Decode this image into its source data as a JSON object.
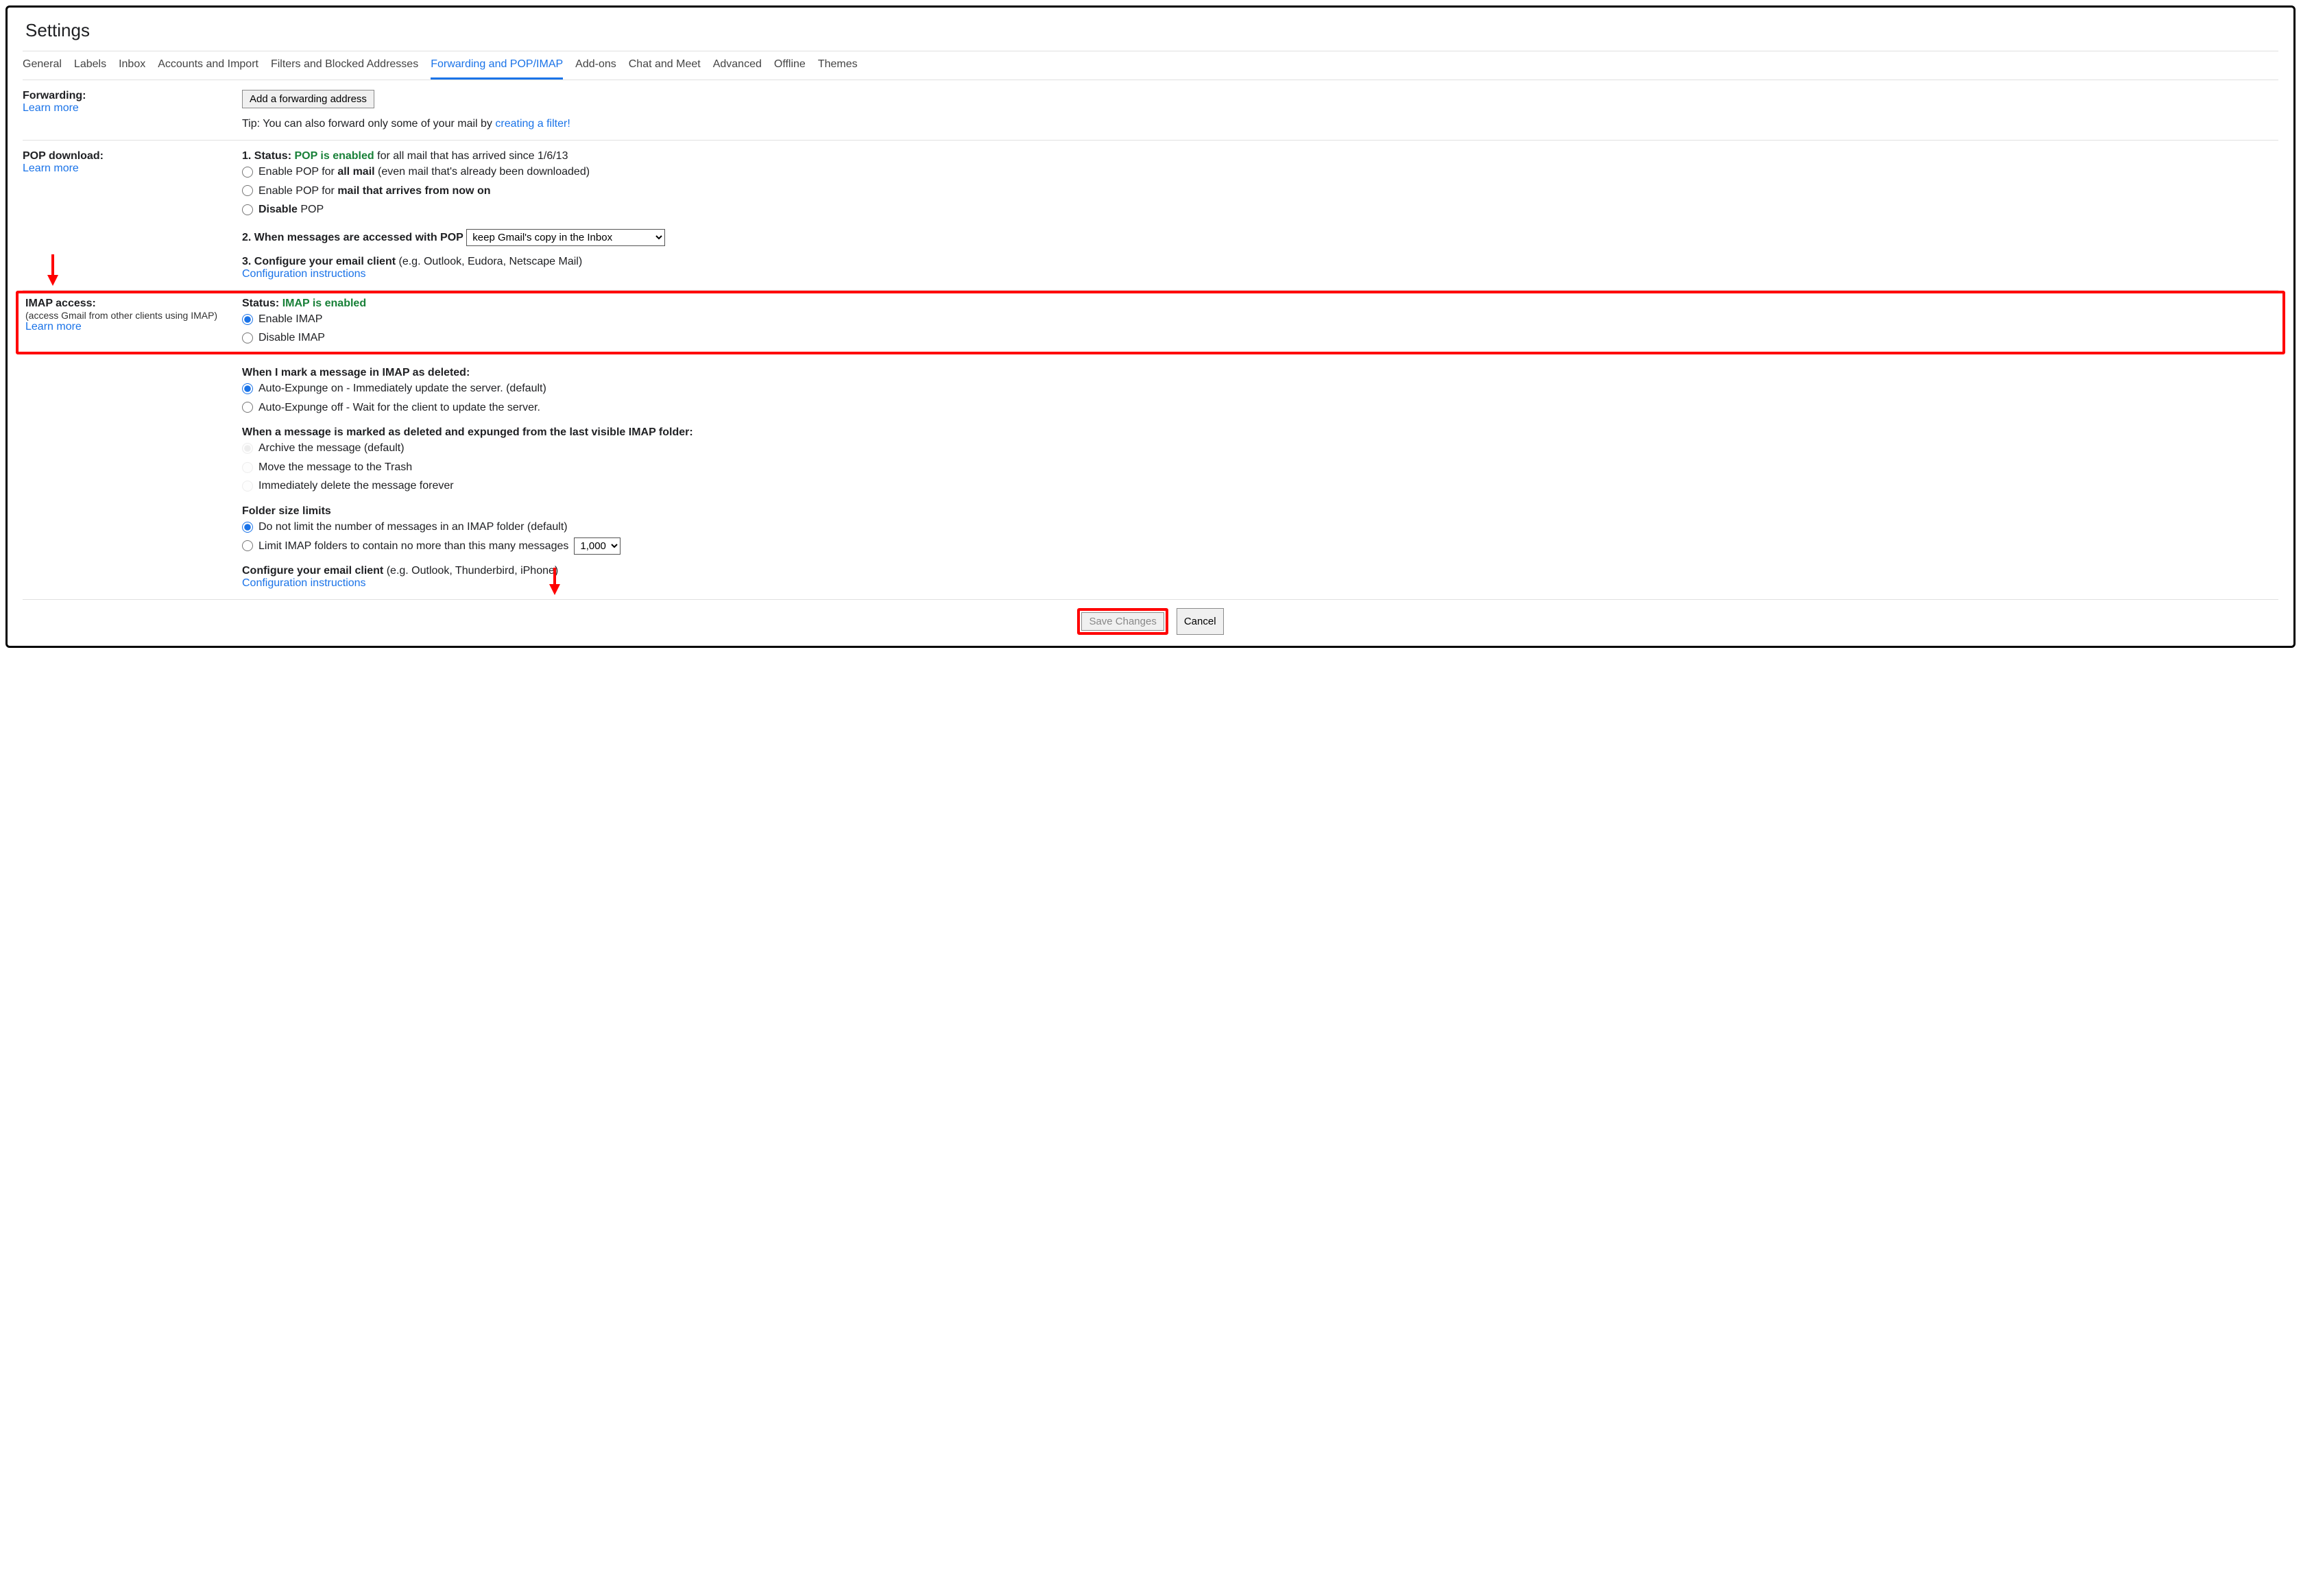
{
  "title": "Settings",
  "tabs": [
    "General",
    "Labels",
    "Inbox",
    "Accounts and Import",
    "Filters and Blocked Addresses",
    "Forwarding and POP/IMAP",
    "Add-ons",
    "Chat and Meet",
    "Advanced",
    "Offline",
    "Themes"
  ],
  "activeTabIndex": 5,
  "forwarding": {
    "heading": "Forwarding:",
    "learn_more": "Learn more",
    "add_button": "Add a forwarding address",
    "tip_prefix": "Tip: You can also forward only some of your mail by ",
    "tip_link": "creating a filter!"
  },
  "pop": {
    "heading": "POP download:",
    "learn_more": "Learn more",
    "status_label": "1. Status:",
    "status_value": "POP is enabled",
    "status_suffix": " for all mail that has arrived since 1/6/13",
    "opt1_prefix": "Enable POP for ",
    "opt1_bold": "all mail",
    "opt1_suffix": " (even mail that's already been downloaded)",
    "opt2_prefix": "Enable POP for ",
    "opt2_bold": "mail that arrives from now on",
    "opt3_bold": "Disable",
    "opt3_suffix": " POP",
    "q2": "2. When messages are accessed with POP",
    "q2_selected": "keep Gmail's copy in the Inbox",
    "q3": "3. Configure your email client",
    "q3_suffix": " (e.g. Outlook, Eudora, Netscape Mail)",
    "config_link": "Configuration instructions"
  },
  "imap": {
    "heading": "IMAP access:",
    "sub": "(access Gmail from other clients using IMAP)",
    "learn_more": "Learn more",
    "status_label": "Status:",
    "status_value": "IMAP is enabled",
    "opt_enable": "Enable IMAP",
    "opt_disable": "Disable IMAP",
    "deleted_heading": "When I mark a message in IMAP as deleted:",
    "deleted_opt1": "Auto-Expunge on - Immediately update the server. (default)",
    "deleted_opt2": "Auto-Expunge off - Wait for the client to update the server.",
    "expunged_heading": "When a message is marked as deleted and expunged from the last visible IMAP folder:",
    "expunged_opt1": "Archive the message (default)",
    "expunged_opt2": "Move the message to the Trash",
    "expunged_opt3": "Immediately delete the message forever",
    "folder_heading": "Folder size limits",
    "folder_opt1": "Do not limit the number of messages in an IMAP folder (default)",
    "folder_opt2": "Limit IMAP folders to contain no more than this many messages",
    "folder_limit_selected": "1,000",
    "configure_heading": "Configure your email client",
    "configure_suffix": " (e.g. Outlook, Thunderbird, iPhone)",
    "config_link": "Configuration instructions"
  },
  "footer": {
    "save": "Save Changes",
    "cancel": "Cancel"
  }
}
